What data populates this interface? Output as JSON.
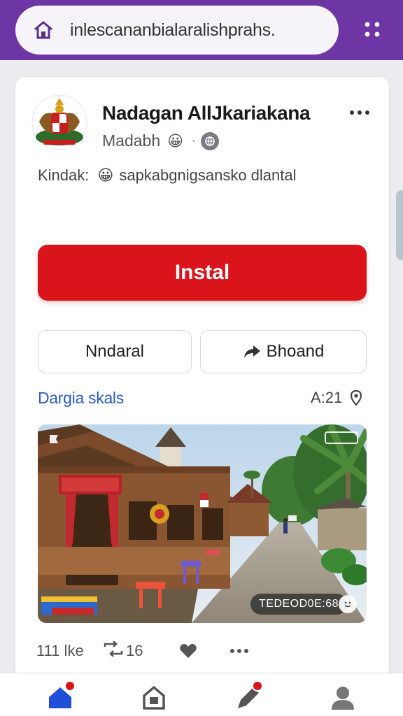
{
  "browser": {
    "url": "inlescananbialaralishprahs.",
    "home_icon": "home-icon",
    "menu_icon": "grid-dots-icon",
    "accent": "#6e36a5"
  },
  "post": {
    "title": "Nadagan AllJkariakana",
    "author": "Madabh",
    "author_emoji": "😀",
    "author_sep": "·",
    "status_label": "Kindak:",
    "status_emoji": "😀",
    "status_text": "sapkabgnigsansko dlantal",
    "install_label": "Instal",
    "install_color": "#d9141a",
    "secondary_left": "Nndaral",
    "secondary_right": "Bhoand",
    "section_title": "Dargia skals",
    "section_meta": "A:21",
    "photo_caption": "TEDEOD0E:68",
    "likes": "111 lke",
    "reposts": "16"
  },
  "nav": {
    "items": [
      "home",
      "store",
      "edit",
      "profile"
    ]
  }
}
